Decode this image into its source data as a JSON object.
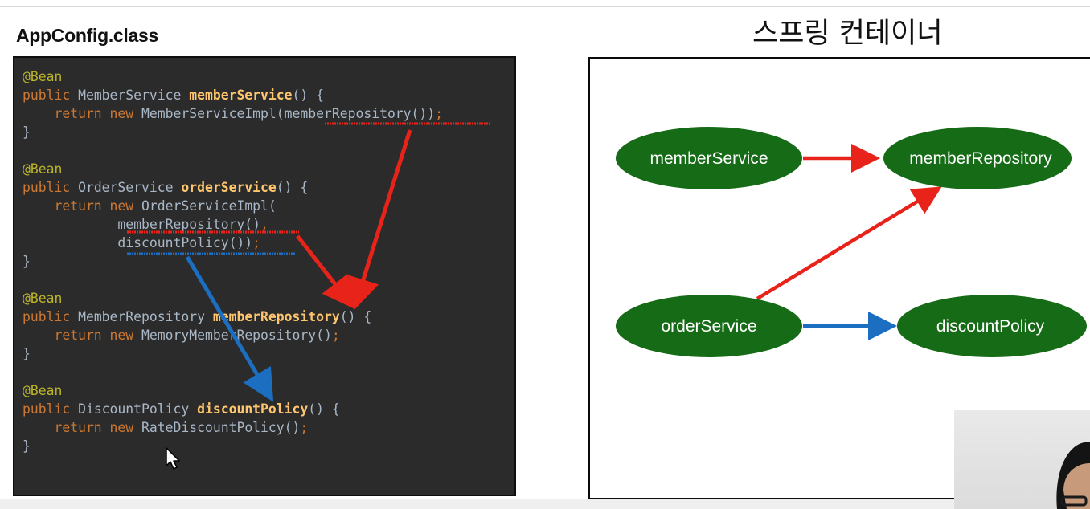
{
  "header": {
    "left_title": "AppConfig.class",
    "right_title": "스프링 컨테이너"
  },
  "code": {
    "lines": [
      [
        {
          "t": "@Bean",
          "c": "ann"
        }
      ],
      [
        {
          "t": "public ",
          "c": "kw"
        },
        {
          "t": "MemberService ",
          "c": "plain"
        },
        {
          "t": "memberService",
          "c": "fn"
        },
        {
          "t": "() {",
          "c": "plain"
        }
      ],
      [
        {
          "t": "    return new ",
          "c": "kw"
        },
        {
          "t": "MemberServiceImpl(memberRepository())",
          "c": "plain"
        },
        {
          "t": ";",
          "c": "punct"
        }
      ],
      [
        {
          "t": "}",
          "c": "plain"
        }
      ],
      [
        {
          "t": "",
          "c": "plain"
        }
      ],
      [
        {
          "t": "@Bean",
          "c": "ann"
        }
      ],
      [
        {
          "t": "public ",
          "c": "kw"
        },
        {
          "t": "OrderService ",
          "c": "plain"
        },
        {
          "t": "orderService",
          "c": "fn"
        },
        {
          "t": "() {",
          "c": "plain"
        }
      ],
      [
        {
          "t": "    return new ",
          "c": "kw"
        },
        {
          "t": "OrderServiceImpl(",
          "c": "plain"
        }
      ],
      [
        {
          "t": "            memberRepository()",
          "c": "plain"
        },
        {
          "t": ",",
          "c": "punct"
        }
      ],
      [
        {
          "t": "            discountPolicy())",
          "c": "plain"
        },
        {
          "t": ";",
          "c": "punct"
        }
      ],
      [
        {
          "t": "}",
          "c": "plain"
        }
      ],
      [
        {
          "t": "",
          "c": "plain"
        }
      ],
      [
        {
          "t": "@Bean",
          "c": "ann"
        }
      ],
      [
        {
          "t": "public ",
          "c": "kw"
        },
        {
          "t": "MemberRepository ",
          "c": "plain"
        },
        {
          "t": "memberRepository",
          "c": "fn"
        },
        {
          "t": "() {",
          "c": "plain"
        }
      ],
      [
        {
          "t": "    return new ",
          "c": "kw"
        },
        {
          "t": "MemoryMemberRepository()",
          "c": "plain"
        },
        {
          "t": ";",
          "c": "punct"
        }
      ],
      [
        {
          "t": "}",
          "c": "plain"
        }
      ],
      [
        {
          "t": "",
          "c": "plain"
        }
      ],
      [
        {
          "t": "@Bean",
          "c": "ann"
        }
      ],
      [
        {
          "t": "public ",
          "c": "kw"
        },
        {
          "t": "DiscountPolicy ",
          "c": "plain"
        },
        {
          "t": "discountPolicy",
          "c": "fn"
        },
        {
          "t": "() {",
          "c": "plain"
        }
      ],
      [
        {
          "t": "    return new ",
          "c": "kw"
        },
        {
          "t": "RateDiscountPolicy()",
          "c": "plain"
        },
        {
          "t": ";",
          "c": "punct"
        }
      ],
      [
        {
          "t": "}",
          "c": "plain"
        }
      ]
    ]
  },
  "diagram": {
    "nodes": {
      "memberService": "memberService",
      "memberRepository": "memberRepository",
      "orderService": "orderService",
      "discountPolicy": "discountPolicy"
    },
    "edges": [
      {
        "from": "memberService",
        "to": "memberRepository",
        "color": "#e8231a"
      },
      {
        "from": "orderService",
        "to": "memberRepository",
        "color": "#e8231a"
      },
      {
        "from": "orderService",
        "to": "discountPolicy",
        "color": "#1c6fc0"
      }
    ]
  },
  "colors": {
    "node_fill": "#166b16",
    "arrow_red": "#e8231a",
    "arrow_blue": "#1c6fc0",
    "code_bg": "#2b2b2b"
  },
  "icons": {
    "cursor": "mouse-pointer-icon"
  }
}
